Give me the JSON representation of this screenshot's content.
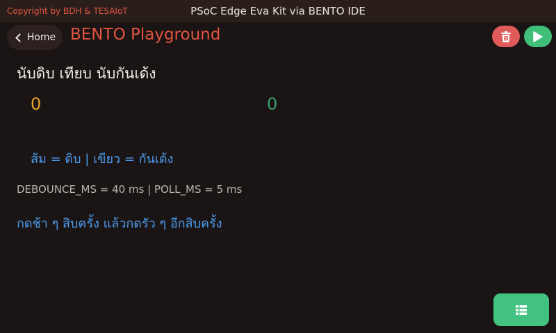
{
  "topbar": {
    "copyright": "Copyright by BDH & TESAIoT",
    "window_title": "PSoC Edge Eva Kit via BENTO IDE"
  },
  "header": {
    "home_label": "Home",
    "app_title": "BENTO Playground",
    "icons": {
      "home": "chevron-left-icon",
      "clear": "trash-icon",
      "run": "play-icon",
      "menu": "list-icon"
    }
  },
  "main": {
    "heading": "นับดิบ เทียบ นับกันเด้ง",
    "raw_count": "0",
    "debounced_count": "0",
    "legend": "ส้ม = ดิบ | เขียว = กันเด้ง",
    "config": "DEBOUNCE_MS = 40 ms | POLL_MS = 5 ms",
    "instruction": "กดช้า ๆ สิบครั้ง แล้วกดรัว ๆ อีกสิบครั้ง"
  },
  "colors": {
    "accent": "#e2543f",
    "raw": "#e5a32a",
    "debounced": "#3aa26a",
    "info": "#4a9df0",
    "clear_button": "#e05a5a",
    "run_button": "#3fbf78"
  }
}
